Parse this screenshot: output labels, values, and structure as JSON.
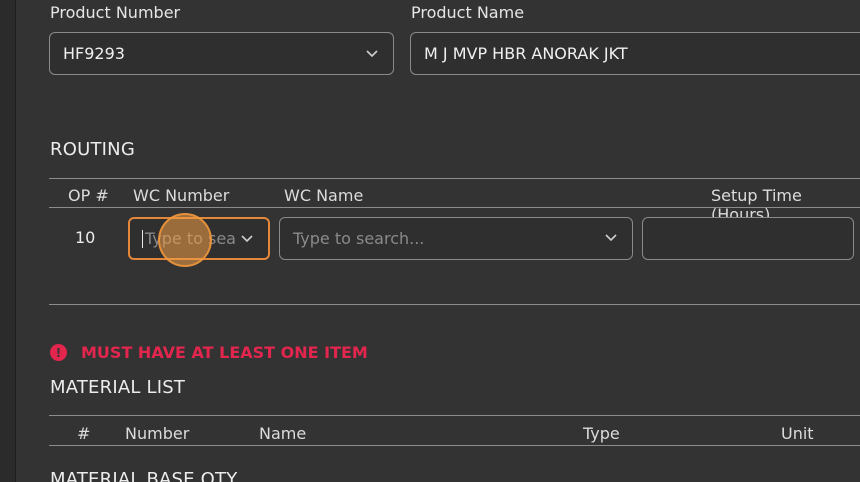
{
  "product": {
    "number_label": "Product Number",
    "number_value": "HF9293",
    "name_label": "Product Name",
    "name_value": "M J MVP HBR ANORAK JKT"
  },
  "routing": {
    "title": "ROUTING",
    "columns": [
      "OP #",
      "WC Number",
      "WC Name",
      "Setup Time (Hours)"
    ],
    "rows": [
      {
        "op": "10",
        "wc_number_placeholder": "Type to sea",
        "wc_name_placeholder": "Type to search...",
        "setup_time": ""
      }
    ]
  },
  "error": {
    "icon": "exclamation-circle-icon",
    "message": "MUST HAVE AT LEAST ONE ITEM",
    "color": "#e2264d"
  },
  "material_list": {
    "title": "MATERIAL LIST",
    "columns": [
      "#",
      "Number",
      "Name",
      "Type",
      "Unit"
    ]
  },
  "material_base_qty": {
    "title": "MATERIAL BASE QTY"
  },
  "accent": {
    "focus_border": "#e3883a",
    "cursor": "#f29e46"
  }
}
